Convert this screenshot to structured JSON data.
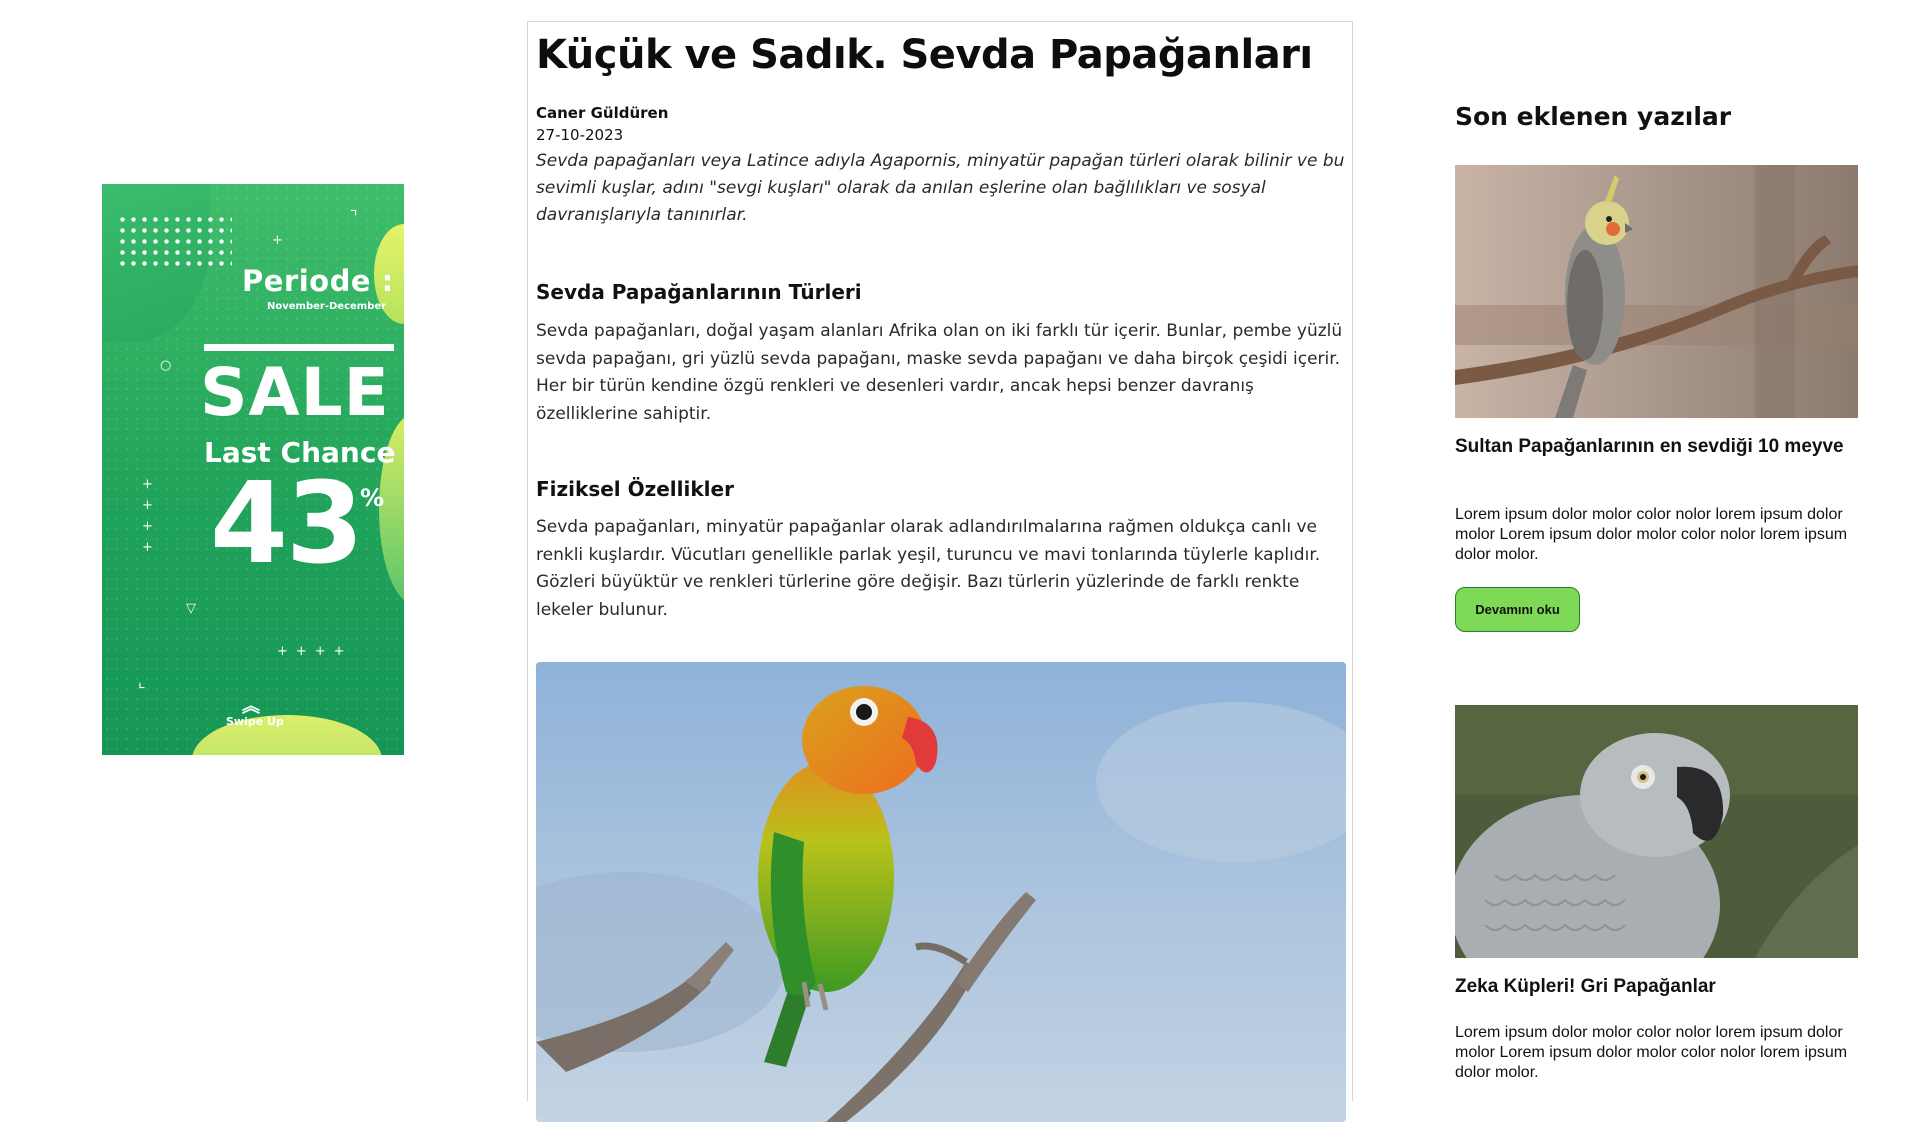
{
  "ad": {
    "periode": "Periode :",
    "months": "November-December",
    "sale": "SALE",
    "last_chance": "Last Chance",
    "percent": "43",
    "percent_sign": "%",
    "swipe_up": "Swipe Up",
    "colors": {
      "green": "#22a35a",
      "lime": "#d8ee66"
    }
  },
  "article": {
    "title": "Küçük ve Sadık. Sevda Papağanları",
    "author": "Caner Güldüren",
    "date": "27-10-2023",
    "lead": "Sevda papağanları veya Latince adıyla Agapornis, minyatür papağan türleri olarak bilinir ve bu sevimli kuşlar, adını \"sevgi kuşları\" olarak da anılan eşlerine olan bağlılıkları ve sosyal davranışlarıyla tanınırlar.",
    "sections": [
      {
        "heading": "Sevda Papağanlarının Türleri",
        "body": "Sevda papağanları, doğal yaşam alanları Afrika olan on iki farklı tür içerir. Bunlar, pembe yüzlü sevda papağanı, gri yüzlü sevda papağanı, maske sevda papağanı ve daha birçok çeşidi içerir. Her bir türün kendine özgü renkleri ve desenleri vardır, ancak hepsi benzer davranış özelliklerine sahiptir."
      },
      {
        "heading": "Fiziksel Özellikler",
        "body": "Sevda papağanları, minyatür papağanlar olarak adlandırılmalarına rağmen oldukça canlı ve renkli kuşlardır. Vücutları genellikle parlak yeşil, turuncu ve mavi tonlarında tüylerle kaplıdır. Gözleri büyüktür ve renkleri türlerine göre değişir. Bazı türlerin yüzlerinde de farklı renkte lekeler bulunur."
      }
    ]
  },
  "sidebar": {
    "title": "Son eklenen yazılar",
    "posts": [
      {
        "title": "Sultan Papağanlarının en sevdiği 10 meyve",
        "excerpt": "Lorem ipsum dolor molor color nolor lorem ipsum dolor molor Lorem ipsum dolor molor color nolor lorem ipsum dolor molor.",
        "button": "Devamını oku"
      },
      {
        "title": "Zeka Küpleri! Gri Papağanlar",
        "excerpt": "Lorem ipsum dolor molor color nolor lorem ipsum dolor molor Lorem ipsum dolor molor color nolor lorem ipsum dolor molor."
      }
    ],
    "button_color": "#7ed957"
  }
}
